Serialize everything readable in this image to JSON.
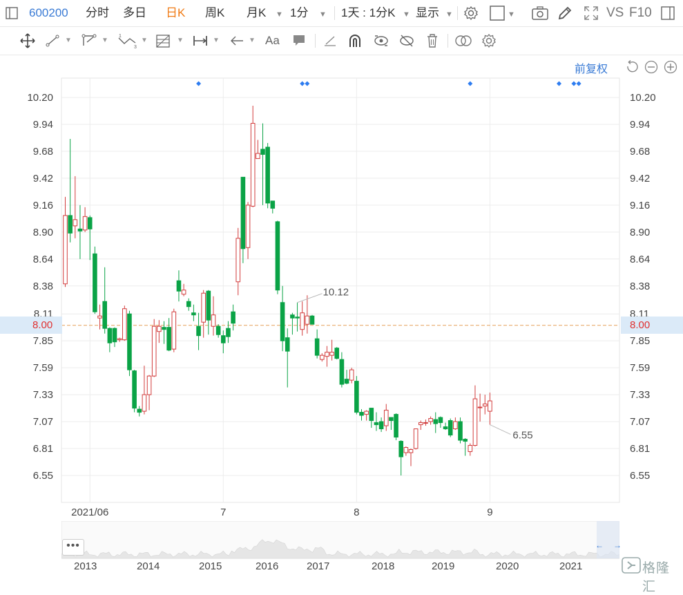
{
  "toolbar": {
    "stock_code": "600200",
    "tabs": [
      "分时",
      "多日",
      "日K",
      "周K",
      "月K",
      "1分",
      "1天 : 1分K",
      "显示"
    ],
    "active_tab": "日K",
    "vs_label": "VS",
    "f10_label": "F10",
    "text_tool_label": "Aa"
  },
  "chart_header": {
    "adjust_mode": "前复权"
  },
  "colors": {
    "up": "#d23b3b",
    "down": "#0aa346",
    "accent": "#3a7bd5",
    "current_line": "#e5a15a",
    "current_text": "#e03030"
  },
  "chart_data": {
    "type": "candlestick",
    "x_labels": [
      "2021/06",
      "7",
      "8",
      "9"
    ],
    "x_label_index": [
      5,
      32,
      59,
      86
    ],
    "y_ticks": [
      10.2,
      9.94,
      9.68,
      9.42,
      9.16,
      8.9,
      8.64,
      8.38,
      8.11,
      7.85,
      7.59,
      7.33,
      7.07,
      6.81,
      6.55
    ],
    "ylim": [
      6.3,
      10.43
    ],
    "current_price": "8.00",
    "high_annotation": {
      "label": "10.12",
      "index": 47
    },
    "low_annotation": {
      "label": "6.55",
      "index": 86
    },
    "markers_index": [
      27,
      48,
      49,
      82,
      100,
      103,
      104
    ],
    "candles": [
      [
        8.4,
        9.06,
        8.37,
        9.24
      ],
      [
        9.06,
        8.89,
        8.8,
        9.8
      ],
      [
        8.96,
        9.02,
        8.84,
        9.44
      ],
      [
        8.93,
        8.91,
        8.64,
        9.16
      ],
      [
        8.92,
        9.05,
        8.9,
        9.14
      ],
      [
        9.04,
        8.93,
        8.63,
        9.06
      ],
      [
        8.69,
        8.13,
        8.11,
        8.76
      ],
      [
        8.07,
        8.09,
        7.96,
        8.2
      ],
      [
        8.23,
        7.97,
        7.92,
        8.56
      ],
      [
        7.97,
        7.83,
        7.74,
        7.98
      ],
      [
        7.97,
        7.84,
        7.79,
        7.98
      ],
      [
        7.86,
        7.87,
        7.84,
        7.88
      ],
      [
        7.86,
        8.16,
        7.85,
        8.19
      ],
      [
        8.11,
        7.57,
        7.51,
        8.14
      ],
      [
        7.56,
        7.2,
        7.16,
        7.57
      ],
      [
        7.19,
        7.16,
        7.12,
        7.22
      ],
      [
        7.17,
        7.33,
        7.14,
        7.61
      ],
      [
        7.33,
        7.51,
        7.18,
        7.52
      ],
      [
        7.51,
        7.99,
        7.5,
        8.06
      ],
      [
        7.94,
        7.99,
        7.83,
        8.05
      ],
      [
        7.98,
        7.96,
        7.82,
        8.04
      ],
      [
        7.98,
        7.76,
        7.75,
        8.07
      ],
      [
        7.77,
        8.13,
        7.74,
        8.16
      ],
      [
        8.43,
        8.33,
        8.23,
        8.53
      ],
      [
        8.3,
        8.34,
        8.28,
        8.4
      ],
      [
        8.23,
        8.18,
        8.14,
        8.26
      ],
      [
        8.12,
        8.1,
        8.04,
        8.2
      ],
      [
        7.99,
        7.9,
        7.76,
        8.12
      ],
      [
        8.03,
        8.31,
        7.88,
        8.34
      ],
      [
        8.33,
        8.05,
        7.91,
        8.34
      ],
      [
        7.99,
        8.1,
        7.9,
        8.28
      ],
      [
        7.99,
        7.91,
        7.88,
        8.01
      ],
      [
        7.9,
        7.83,
        7.73,
        7.95
      ],
      [
        7.97,
        7.89,
        7.83,
        8.04
      ],
      [
        8.13,
        8.02,
        7.95,
        8.2
      ],
      [
        8.42,
        8.84,
        8.29,
        8.94
      ],
      [
        9.43,
        8.74,
        8.6,
        9.43
      ],
      [
        8.75,
        9.16,
        8.64,
        9.19
      ],
      [
        9.15,
        9.95,
        9.14,
        10.12
      ],
      [
        9.61,
        9.66,
        9.63,
        9.79
      ],
      [
        9.7,
        9.65,
        9.16,
        9.95
      ],
      [
        9.72,
        9.18,
        9.13,
        9.76
      ],
      [
        9.2,
        9.13,
        9.08,
        9.18
      ],
      [
        9.0,
        8.34,
        8.3,
        9.01
      ],
      [
        8.22,
        7.85,
        7.75,
        8.38
      ],
      [
        7.88,
        7.75,
        7.4,
        7.97
      ],
      [
        8.1,
        8.07,
        7.91,
        8.12
      ],
      [
        8.08,
        8.07,
        7.94,
        8.22
      ],
      [
        7.96,
        8.12,
        7.9,
        8.23
      ],
      [
        8.01,
        8.09,
        7.92,
        8.29
      ],
      [
        8.09,
        8.01,
        8.02,
        8.1
      ],
      [
        7.87,
        7.71,
        7.68,
        7.96
      ],
      [
        7.67,
        7.71,
        7.65,
        7.73
      ],
      [
        7.7,
        7.74,
        7.6,
        7.8
      ],
      [
        7.71,
        7.74,
        7.66,
        7.86
      ],
      [
        7.78,
        7.68,
        7.67,
        7.79
      ],
      [
        7.67,
        7.43,
        7.4,
        7.74
      ],
      [
        7.48,
        7.44,
        7.43,
        7.57
      ],
      [
        7.47,
        7.57,
        7.44,
        7.59
      ],
      [
        7.46,
        7.16,
        7.14,
        7.51
      ],
      [
        7.16,
        7.13,
        7.08,
        7.19
      ],
      [
        7.14,
        7.17,
        7.08,
        7.18
      ],
      [
        7.2,
        7.08,
        7.01,
        7.19
      ],
      [
        7.06,
        7.04,
        6.98,
        7.16
      ],
      [
        7.07,
        7.0,
        6.97,
        7.11
      ],
      [
        7.03,
        7.18,
        6.98,
        7.24
      ],
      [
        7.11,
        7.08,
        6.99,
        7.1
      ],
      [
        7.14,
        6.92,
        6.89,
        7.15
      ],
      [
        6.88,
        6.73,
        6.55,
        6.89
      ],
      [
        6.77,
        6.82,
        6.74,
        6.83
      ],
      [
        6.77,
        6.8,
        6.64,
        6.81
      ],
      [
        6.81,
        7.0,
        6.8,
        7.0
      ],
      [
        7.04,
        7.06,
        6.99,
        7.08
      ],
      [
        7.06,
        7.06,
        7.03,
        7.09
      ],
      [
        7.07,
        7.1,
        7.04,
        7.12
      ],
      [
        7.09,
        7.05,
        6.96,
        7.16
      ],
      [
        7.11,
        7.06,
        7.01,
        7.12
      ],
      [
        7.02,
        7.0,
        6.99,
        7.06
      ],
      [
        7.08,
        6.94,
        6.92,
        7.1
      ],
      [
        7.0,
        7.07,
        6.99,
        7.11
      ],
      [
        7.07,
        6.89,
        6.86,
        7.11
      ],
      [
        6.9,
        6.88,
        6.74,
        6.91
      ],
      [
        6.78,
        6.84,
        6.74,
        6.86
      ],
      [
        6.84,
        7.29,
        6.83,
        7.42
      ],
      [
        7.21,
        7.21,
        7.07,
        7.34
      ],
      [
        7.22,
        7.24,
        7.14,
        7.33
      ],
      [
        7.17,
        7.27,
        7.04,
        7.35
      ]
    ]
  },
  "navigator": {
    "button_label": "•••",
    "years": [
      "2013",
      "2014",
      "2015",
      "2016",
      "2017",
      "2018",
      "2019",
      "2020",
      "2021"
    ],
    "left_arrow": "←",
    "right_arrow": "→"
  },
  "logo": {
    "text": "格隆汇"
  }
}
